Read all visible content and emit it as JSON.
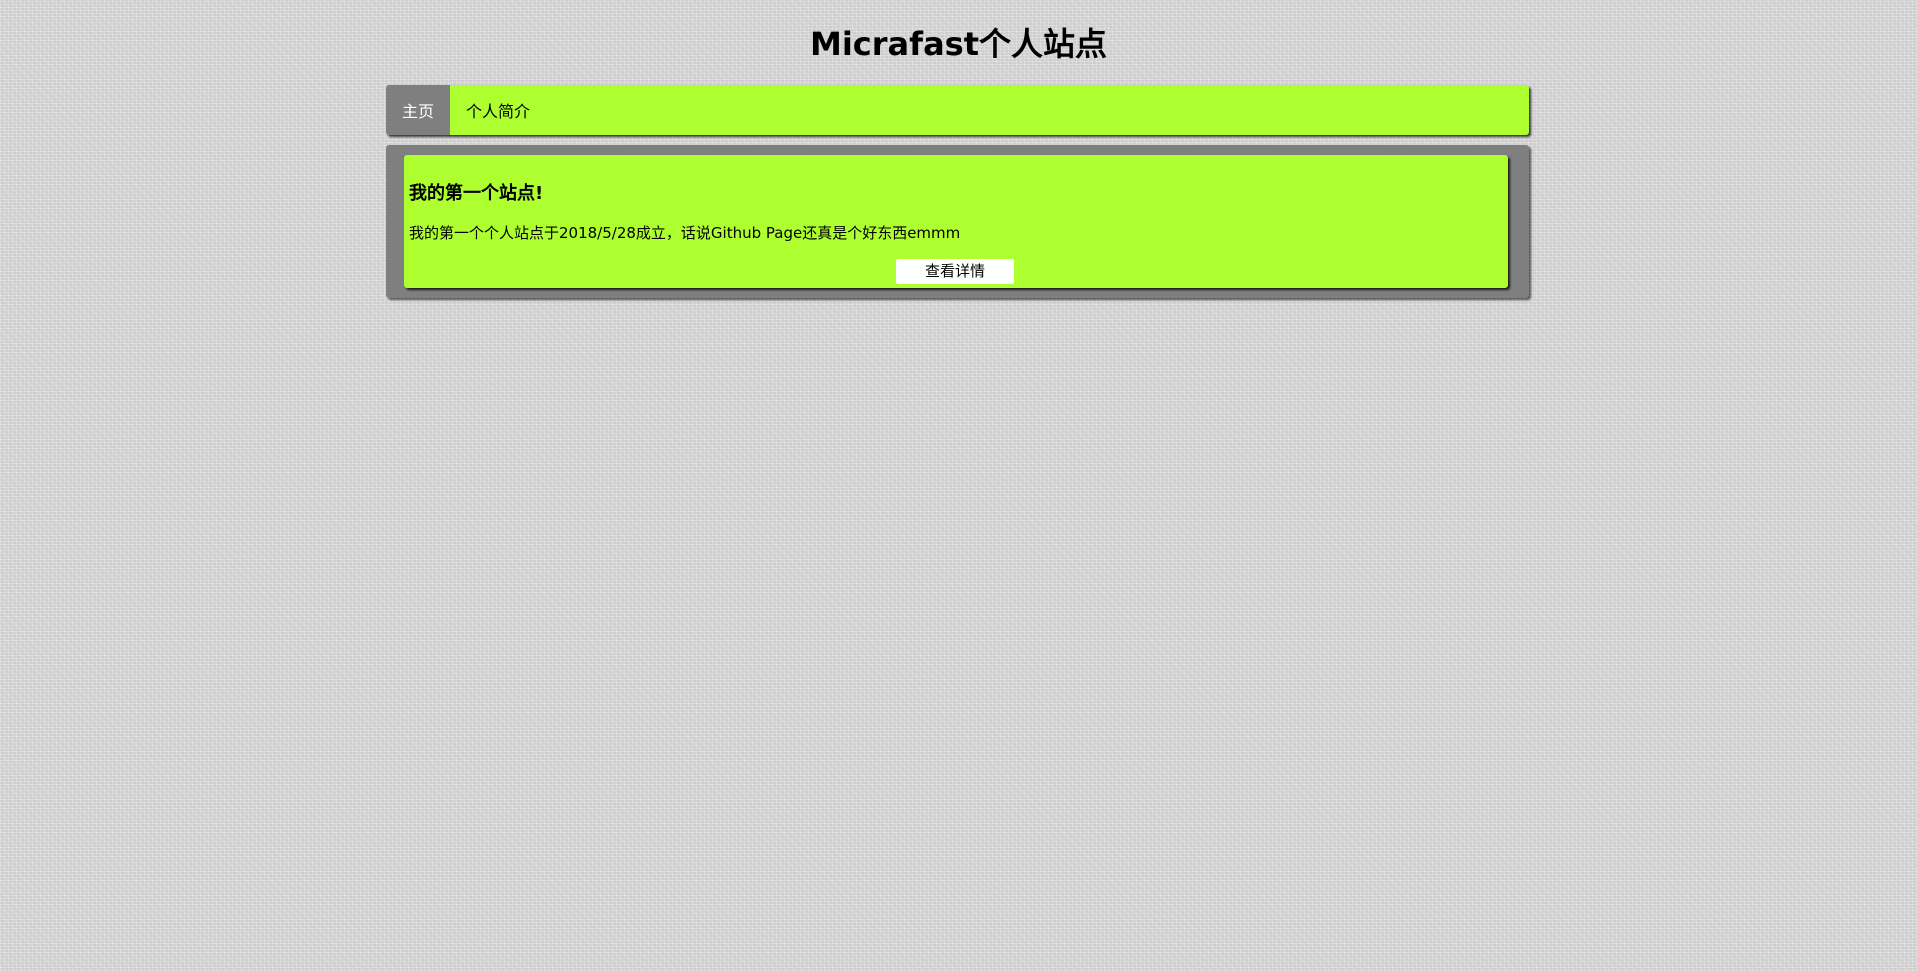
{
  "site": {
    "title": "Micrafast个人站点"
  },
  "nav": {
    "items": [
      {
        "label": "主页",
        "active": true
      },
      {
        "label": "个人简介",
        "active": false
      }
    ]
  },
  "posts": [
    {
      "title": "我的第一个站点!",
      "text": "我的第一个个人站点于2018/5/28成立，话说Github Page还真是个好东西emmm",
      "button_label": "查看详情"
    }
  ],
  "colors": {
    "accent": "#adff2f",
    "nav_active_bg": "#7f7f7f",
    "content_bg": "#7f7f7f",
    "page_bg": "#d9d9d9"
  }
}
